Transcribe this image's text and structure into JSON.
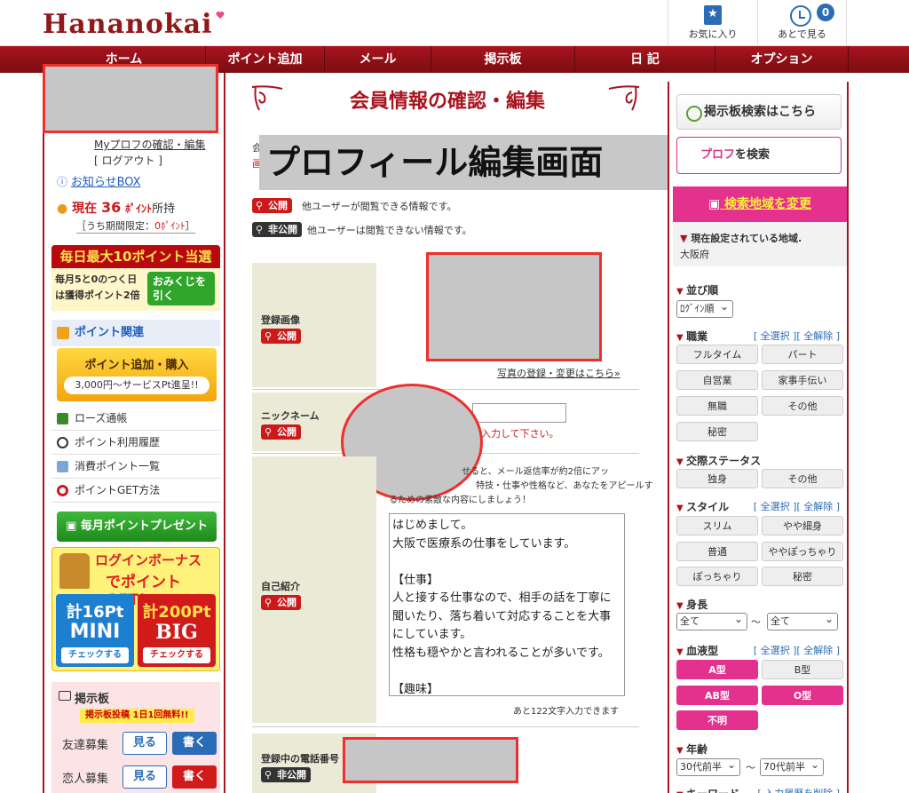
{
  "header": {
    "logo": "Hananokai",
    "favorites_label": "お気に入り",
    "later_label": "あとで見る",
    "later_count": "0"
  },
  "nav": [
    "ホーム",
    "ポイント追加",
    "メール",
    "掲示板",
    "日 記",
    "オプション"
  ],
  "left": {
    "profile_link": "Myプロフの確認・編集",
    "logout": "[ ログアウト ]",
    "news": "お知らせBOX",
    "points_prefix": "現在",
    "points_value": "36",
    "points_unit": "ﾎﾟｲﾝﾄ",
    "points_suffix": "所持",
    "limited": "［うち期間限定：",
    "limited_value": "0ﾎﾟｲﾝﾄ",
    "limited_end": "］",
    "promo_top": "毎日最大10ポイント当選",
    "promo_body": "毎月5と0のつく日は獲得ポイント2倍",
    "promo_button": "おみくじを引く",
    "points_section": "ポイント関連",
    "buy_title": "ポイント追加・購入",
    "buy_sub": "3,000円〜サービスPt進呈!!",
    "menu": [
      "ローズ通帳",
      "ポイント利用履歴",
      "消費ポイント一覧",
      "ポイントGET方法"
    ],
    "monthly_gift": "毎月ポイントプレゼント",
    "bonus_title1": "ログインボーナス",
    "bonus_title2": "でポイントGET!",
    "bonus_mini_pts": "計16Pt",
    "bonus_mini": "MINI",
    "bonus_big_pts": "計200Pt",
    "bonus_big": "BIG",
    "bonus_check": "チェックする",
    "board_title": "掲示板",
    "board_free": "掲示板投稿 1日1回無料!!",
    "board_rows": [
      "友達募集",
      "恋人募集"
    ],
    "see": "見る",
    "write": "書く"
  },
  "main": {
    "title": "会員情報の確認・編集",
    "overlay": "プロフィール編集画面",
    "frag1": "会",
    "frag2": "画",
    "public": "公開",
    "private": "非公開",
    "public_desc": "他ユーザーが閲覧できる情報です。",
    "private_desc": "他ユーザーは閲覧できない情報です。",
    "photo_label": "登録画像",
    "photo_link": "写真の登録・変更はこちら»",
    "nick_label": "ニックネーム",
    "nick_hint": "入力して下さい。",
    "intro_label": "自己紹介",
    "intro_tip1": "せると、メール返信率が約2倍にアッ",
    "intro_tip2": "特技・仕事や性格など、あなたをアピールす",
    "intro_tip3": "るための素敵な内容にしましょう！",
    "intro_lines": [
      "はじめまして。",
      "大阪で医療系の仕事をしています。",
      "",
      "【仕事】",
      "人と接する仕事なので、相手の話を丁寧に",
      "聞いたり、落ち着いて対応することを大事",
      "にしています。",
      "性格も穏やかと言われることが多いです。",
      "",
      "【趣味】"
    ],
    "remaining": "あと122文字入力できます",
    "phone_label": "登録中の電話番号"
  },
  "right": {
    "board_search": "掲示板検索はこちら",
    "prof_search_a": "プロフ",
    "prof_search_b": "を検索",
    "area_change": "検索地域を変更",
    "current_area_label": "現在設定されている地域.",
    "current_area": "大阪府",
    "sort_label": "並び順",
    "sort_value": "ﾛｸﾞｲﾝ順",
    "job_label": "職業",
    "select_all": "[ 全選択 ]",
    "clear_all": "[ 全解除 ]",
    "jobs": [
      "フルタイム",
      "パート",
      "自営業",
      "家事手伝い",
      "無職",
      "その他",
      "秘密"
    ],
    "rel_label": "交際ステータス",
    "rels": [
      "独身",
      "その他"
    ],
    "style_label": "スタイル",
    "styles": [
      "スリム",
      "やや細身",
      "普通",
      "ややぽっちゃり",
      "ぽっちゃり",
      "秘密"
    ],
    "height_label": "身長",
    "height_from": "全て",
    "height_to": "全て",
    "tilde": "〜",
    "blood_label": "血液型",
    "blood": [
      "A型",
      "B型",
      "AB型",
      "O型",
      "不明"
    ],
    "age_label": "年齢",
    "age_from": "30代前半",
    "age_to": "70代前半",
    "keyword_label": "キーワード",
    "keyword_link": "[ 入力履歴を削除 ]"
  },
  "colors": {
    "brand_red": "#a8141e",
    "accent_pink": "#e3318d",
    "link_blue": "#2b6cb7"
  }
}
